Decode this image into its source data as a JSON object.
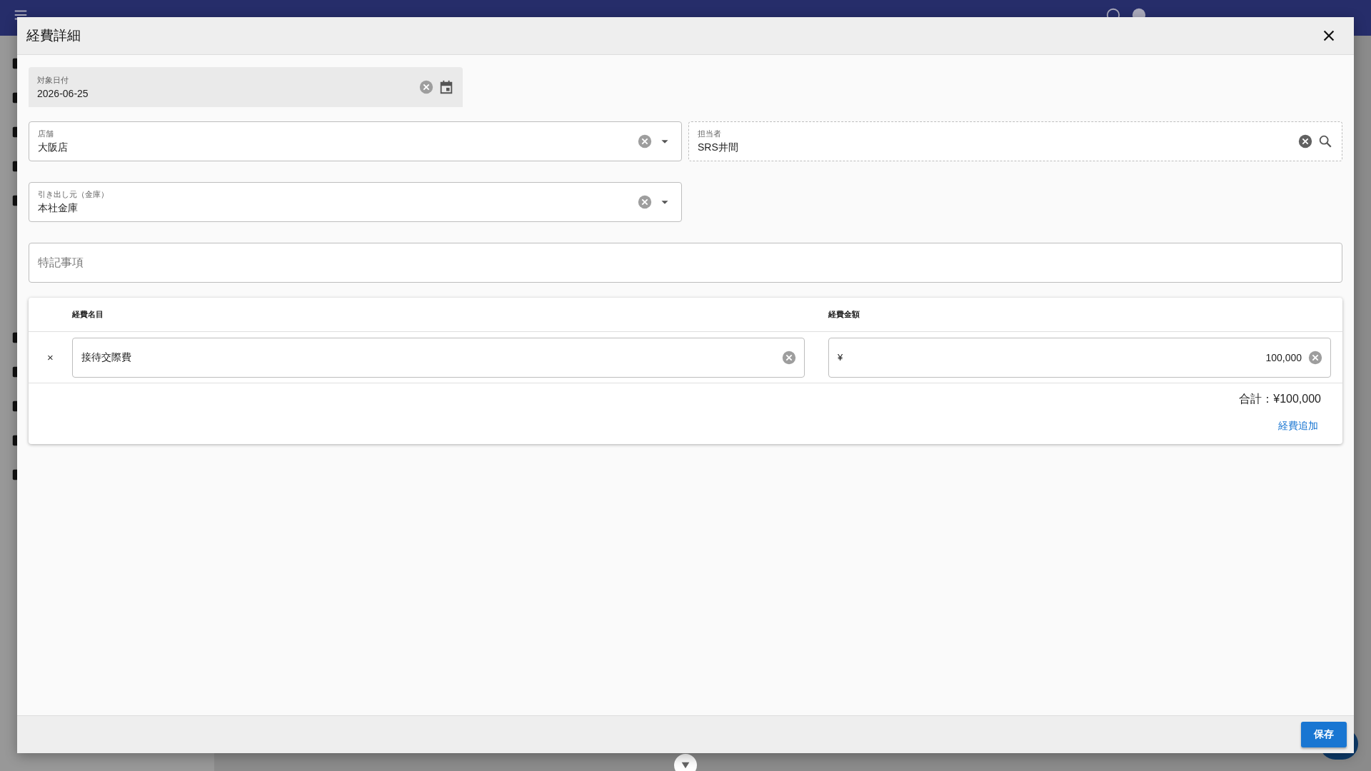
{
  "dialog": {
    "title": "経費詳細",
    "date_field": {
      "kind": "date",
      "label": "対象日付",
      "value": "2026-06-25"
    },
    "store_field": {
      "kind": "select",
      "label": "店舗",
      "value": "大阪店"
    },
    "staff_field": {
      "kind": "search",
      "label": "担当者",
      "value": "SRS井間"
    },
    "source_field": {
      "kind": "select",
      "label": "引き出し元（金庫）",
      "value": "本社金庫"
    },
    "notes_field": {
      "placeholder": "特記事項"
    },
    "table": {
      "columns": [
        "経費名目",
        "経費金額"
      ],
      "rows": [
        {
          "remove": "×",
          "name": "接待交際費",
          "currency": "¥",
          "amount": "100,000"
        }
      ],
      "total": "合計：¥100,000",
      "add_link": "経費追加"
    },
    "save_button": "保存"
  }
}
